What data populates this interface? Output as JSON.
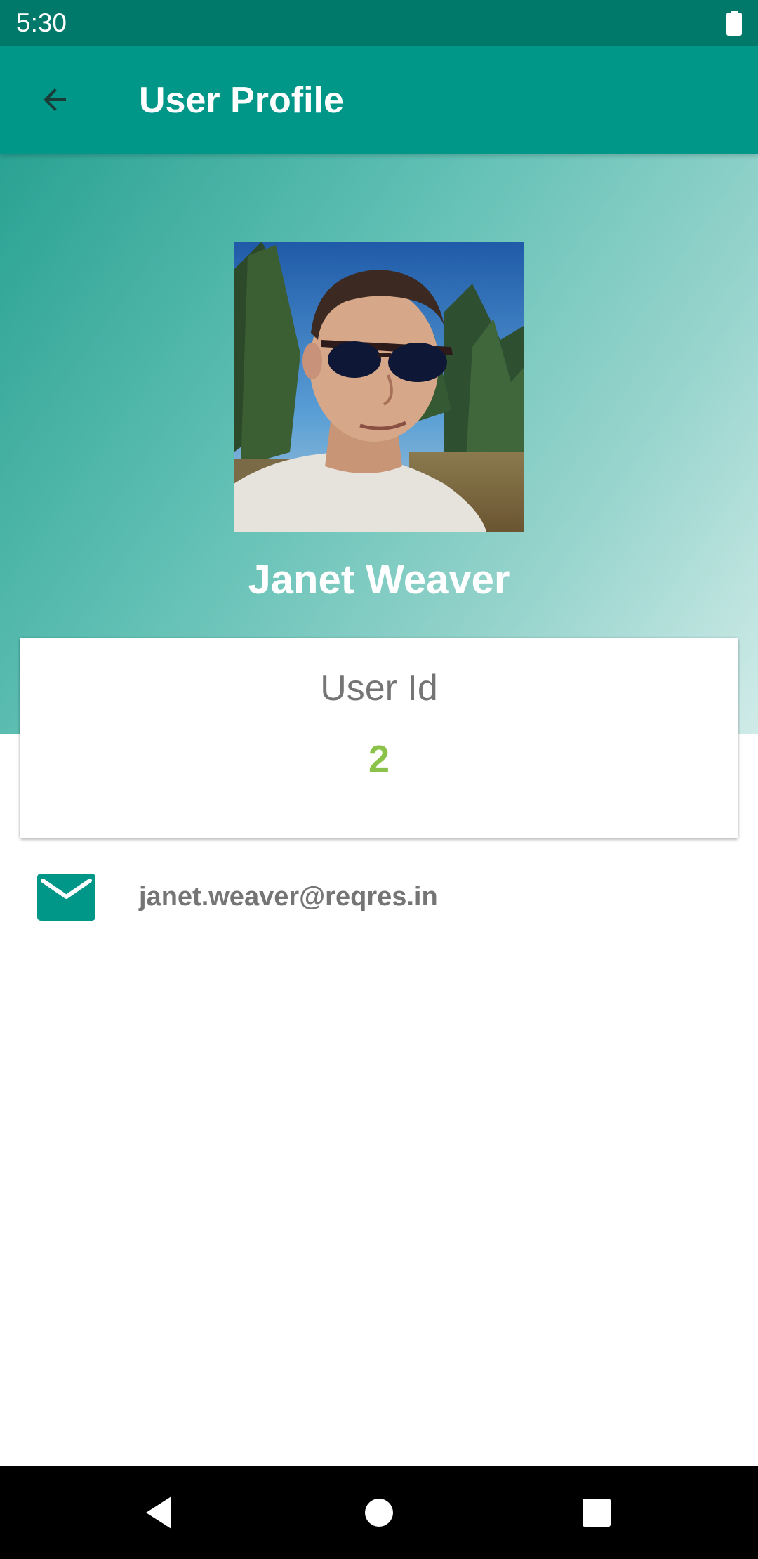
{
  "status_bar": {
    "time": "5:30",
    "battery_icon": "battery-full-icon"
  },
  "app_bar": {
    "title": "User Profile",
    "back_icon": "arrow-back-icon"
  },
  "profile": {
    "name": "Janet Weaver",
    "user_id_label": "User Id",
    "user_id_value": "2",
    "email": "janet.weaver@reqres.in",
    "email_icon": "email-icon"
  },
  "colors": {
    "status_bar": "#00796b",
    "primary": "#009688",
    "user_id_value": "#8bc34a",
    "secondary_text": "#757575"
  },
  "nav_bar": {
    "back_icon": "nav-back-icon",
    "home_icon": "nav-home-icon",
    "recents_icon": "nav-recents-icon"
  }
}
